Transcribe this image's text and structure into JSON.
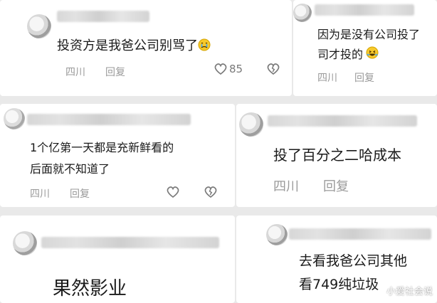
{
  "cards": [
    {
      "comment": "投资方是我爸公司别骂了",
      "location": "四川",
      "reply": "回复",
      "likes": "85",
      "emoji": "crying-face"
    },
    {
      "line1": "因为是没有公司投了",
      "line2": "司才投的",
      "location": "四川",
      "reply": "回复",
      "emoji": "laughing-face"
    },
    {
      "line1": "1个亿第一天都是充新鲜看的",
      "line2": "后面就不知道了",
      "location": "四川",
      "reply": "回复"
    },
    {
      "comment": "投了百分之二哈成本",
      "location": "四川",
      "reply": "回复"
    },
    {
      "comment": "果然影业"
    },
    {
      "line1": "去看我爸公司其他",
      "line2": "看749纯垃圾"
    }
  ],
  "watermark": "小爱社会说"
}
